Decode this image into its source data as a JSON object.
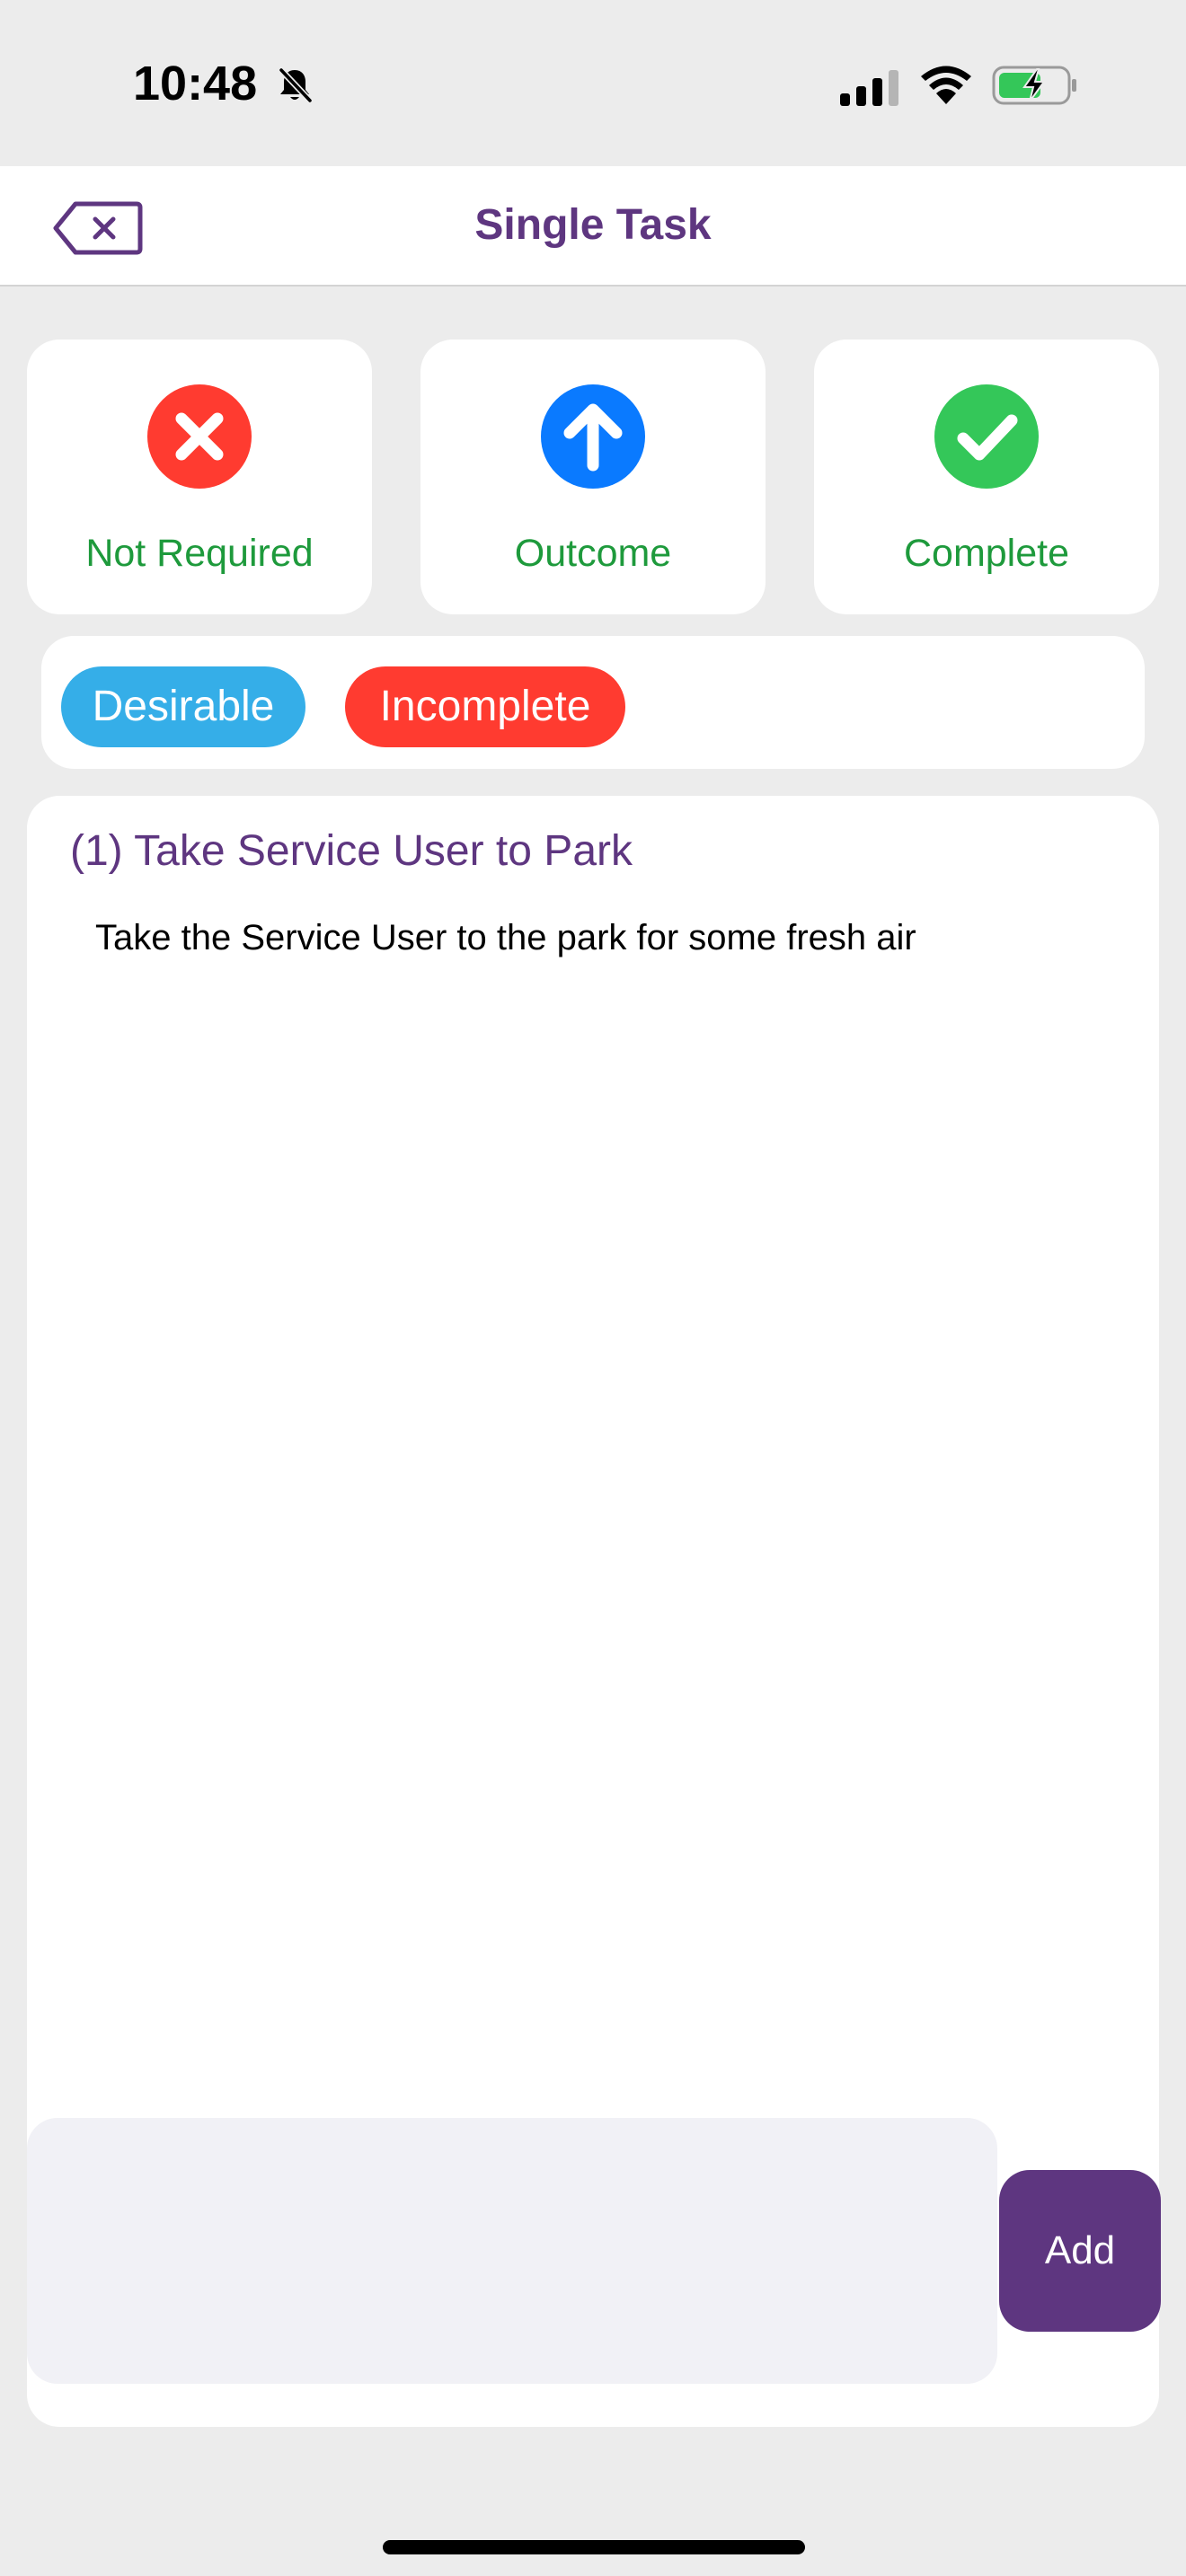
{
  "status_bar": {
    "time": "10:48",
    "icons": [
      "bell-slash-icon",
      "cellular-signal-icon",
      "wifi-icon",
      "battery-charging-icon"
    ]
  },
  "nav": {
    "title": "Single Task",
    "back_icon": "delete-left-icon"
  },
  "status_options": [
    {
      "label": "Not Required",
      "icon": "x-circle-icon",
      "color": "#ff3b30"
    },
    {
      "label": "Outcome",
      "icon": "arrow-up-circle-icon",
      "color": "#0a7aff"
    },
    {
      "label": "Complete",
      "icon": "checkmark-circle-icon",
      "color": "#34c759"
    }
  ],
  "tags": [
    {
      "label": "Desirable",
      "color": "#35aee8"
    },
    {
      "label": "Incomplete",
      "color": "#ff3b30"
    }
  ],
  "task": {
    "title": "(1) Take Service User to Park",
    "description": "Take the Service User to the park for some fresh air"
  },
  "note": {
    "value": "",
    "placeholder": ""
  },
  "add_button_label": "Add",
  "colors": {
    "accent": "#5e3680",
    "status_label": "#1e9a3c",
    "background": "#ececec"
  }
}
